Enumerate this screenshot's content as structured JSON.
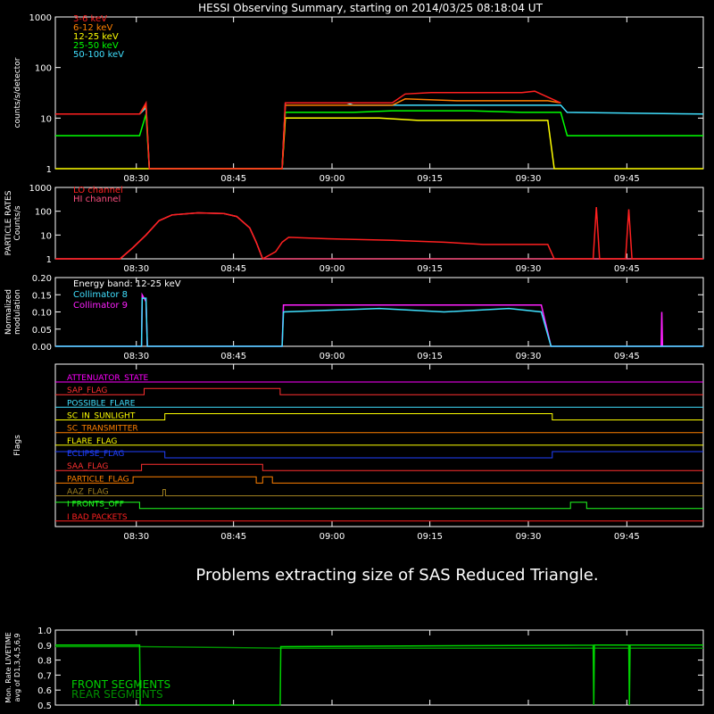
{
  "title": "HESSI Observing Summary, starting on 2014/03/25 08:18:04 UT",
  "message": "Problems extracting size of SAS Reduced Triangle.",
  "time_ticks": [
    "08:30",
    "08:45",
    "09:00",
    "09:15",
    "09:30",
    "09:45"
  ],
  "chart_data": [
    {
      "type": "line",
      "name": "count-rates",
      "ylabel": "counts/s/detector",
      "yscale": "log",
      "ylim": [
        1,
        1000
      ],
      "yticks": [
        "1",
        "10",
        "100",
        "1000"
      ],
      "series": [
        {
          "name": "3-6 keV",
          "color": "#ff2020",
          "points": [
            [
              0,
              12
            ],
            [
              13,
              12
            ],
            [
              14,
              20
            ],
            [
              14.5,
              1
            ],
            [
              35,
              1
            ],
            [
              35.5,
              20
            ],
            [
              52,
              20
            ],
            [
              54,
              30
            ],
            [
              58,
              32
            ],
            [
              72,
              32
            ],
            [
              74,
              34
            ],
            [
              76,
              26
            ],
            [
              78,
              20
            ]
          ]
        },
        {
          "name": "6-12 keV",
          "color": "#ff8000",
          "points": [
            [
              0,
              12
            ],
            [
              13,
              12
            ],
            [
              14,
              18
            ],
            [
              14.5,
              1
            ],
            [
              35,
              1
            ],
            [
              35.5,
              18
            ],
            [
              52,
              18
            ],
            [
              54,
              24
            ],
            [
              62,
              22
            ],
            [
              72,
              22
            ],
            [
              76,
              22
            ],
            [
              78,
              20
            ]
          ]
        },
        {
          "name": "12-25 keV",
          "color": "#ffff00",
          "points": [
            [
              0,
              1
            ],
            [
              35,
              1
            ],
            [
              35.5,
              10
            ],
            [
              50,
              10
            ],
            [
              56,
              9
            ],
            [
              64,
              9
            ],
            [
              72,
              9
            ],
            [
              76,
              9
            ],
            [
              77,
              1
            ],
            [
              100,
              1
            ]
          ]
        },
        {
          "name": "25-50 keV",
          "color": "#00ff00",
          "points": [
            [
              0,
              4.5
            ],
            [
              13,
              4.5
            ],
            [
              14,
              12
            ],
            [
              14.5,
              1
            ],
            [
              35,
              1
            ],
            [
              35.5,
              13
            ],
            [
              46,
              13
            ],
            [
              52,
              14
            ],
            [
              64,
              14
            ],
            [
              72,
              13
            ],
            [
              78,
              13
            ],
            [
              79,
              4.5
            ],
            [
              100,
              4.5
            ]
          ]
        },
        {
          "name": "50-100 keV",
          "color": "#40e0ff",
          "points": [
            [
              0,
              12
            ],
            [
              13,
              12
            ],
            [
              14,
              16
            ],
            [
              14.5,
              1
            ],
            [
              35,
              1
            ],
            [
              35.5,
              20
            ],
            [
              45,
              20
            ],
            [
              46,
              18
            ],
            [
              56,
              18
            ],
            [
              66,
              18
            ],
            [
              72,
              18
            ],
            [
              78,
              18
            ],
            [
              79,
              13
            ],
            [
              100,
              12
            ]
          ]
        }
      ]
    },
    {
      "type": "line",
      "name": "particle-rates",
      "ylabel": "PARTICLE RATES Counts/s",
      "yscale": "log",
      "ylim": [
        1,
        1000
      ],
      "yticks": [
        "1",
        "10",
        "100",
        "1000"
      ],
      "series": [
        {
          "name": "LO channel",
          "color": "#ff2020",
          "points": [
            [
              0,
              1
            ],
            [
              10,
              1
            ],
            [
              12,
              3
            ],
            [
              14,
              10
            ],
            [
              16,
              40
            ],
            [
              18,
              70
            ],
            [
              22,
              85
            ],
            [
              26,
              80
            ],
            [
              28,
              60
            ],
            [
              30,
              20
            ],
            [
              31,
              5
            ],
            [
              32,
              1
            ],
            [
              34,
              2
            ],
            [
              35,
              5
            ],
            [
              36,
              8
            ],
            [
              42,
              7
            ],
            [
              52,
              6
            ],
            [
              60,
              5
            ],
            [
              66,
              4
            ],
            [
              72,
              4
            ],
            [
              76,
              4
            ],
            [
              77,
              1
            ],
            [
              83,
              1
            ],
            [
              83.5,
              150
            ],
            [
              84,
              1
            ],
            [
              88,
              1
            ],
            [
              88.5,
              120
            ],
            [
              89,
              1
            ],
            [
              100,
              1
            ]
          ]
        },
        {
          "name": "HI channel",
          "color": "#ff5080",
          "points": [
            [
              0,
              1
            ],
            [
              10,
              1
            ],
            [
              12,
              3
            ],
            [
              14,
              10
            ],
            [
              16,
              40
            ],
            [
              18,
              70
            ],
            [
              22,
              85
            ],
            [
              26,
              80
            ],
            [
              28,
              60
            ],
            [
              30,
              20
            ],
            [
              31,
              5
            ],
            [
              32,
              1
            ],
            [
              100,
              1
            ]
          ]
        }
      ]
    },
    {
      "type": "line",
      "name": "modulation",
      "ylabel": "Normalized modulation",
      "annotation": "Energy band: 12-25 keV",
      "ylim": [
        0,
        0.2
      ],
      "yticks": [
        "0.00",
        "0.05",
        "0.10",
        "0.15",
        "0.20"
      ],
      "series": [
        {
          "name": "Collimator 8",
          "color": "#40e0ff",
          "points": [
            [
              0,
              0
            ],
            [
              13.3,
              0
            ],
            [
              13.4,
              0.14
            ],
            [
              14,
              0.14
            ],
            [
              14.2,
              0
            ],
            [
              35,
              0
            ],
            [
              35.2,
              0.1
            ],
            [
              50,
              0.11
            ],
            [
              60,
              0.1
            ],
            [
              70,
              0.11
            ],
            [
              75,
              0.1
            ],
            [
              76.5,
              0
            ],
            [
              100,
              0
            ]
          ]
        },
        {
          "name": "Collimator 9",
          "color": "#ff20ff",
          "points": [
            [
              0,
              0
            ],
            [
              13.3,
              0
            ],
            [
              13.4,
              0.15
            ],
            [
              14,
              0.13
            ],
            [
              14.2,
              0
            ],
            [
              35,
              0
            ],
            [
              35.2,
              0.12
            ],
            [
              50,
              0.12
            ],
            [
              60,
              0.12
            ],
            [
              70,
              0.12
            ],
            [
              75,
              0.12
            ],
            [
              76.5,
              0
            ],
            [
              93.5,
              0
            ],
            [
              93.6,
              0.1
            ],
            [
              93.7,
              0
            ],
            [
              100,
              0
            ]
          ]
        }
      ]
    },
    {
      "type": "line",
      "name": "flags",
      "ylabel": "Flags",
      "series": [
        {
          "name": "ATTENUATOR_STATE",
          "color": "#ff00ff",
          "points": [
            [
              0,
              0
            ],
            [
              100,
              0
            ]
          ]
        },
        {
          "name": "SAP_FLAG",
          "color": "#ff3030",
          "points": [
            [
              0,
              0
            ],
            [
              13.7,
              0
            ],
            [
              13.7,
              1
            ],
            [
              34.7,
              1
            ],
            [
              34.7,
              0
            ],
            [
              100,
              0
            ]
          ]
        },
        {
          "name": "POSSIBLE_FLARE",
          "color": "#40e0ff",
          "points": [
            [
              0,
              0
            ],
            [
              100,
              0
            ]
          ]
        },
        {
          "name": "SC_IN_SUNLIGHT",
          "color": "#ffff00",
          "points": [
            [
              0,
              0
            ],
            [
              16.9,
              0
            ],
            [
              16.9,
              1
            ],
            [
              76.7,
              1
            ],
            [
              76.7,
              0
            ],
            [
              100,
              0
            ]
          ]
        },
        {
          "name": "SC_TRANSMITTER",
          "color": "#ff8000",
          "points": [
            [
              0,
              0
            ],
            [
              100,
              0
            ]
          ]
        },
        {
          "name": "FLARE_FLAG",
          "color": "#ffff00",
          "points": [
            [
              0,
              0
            ],
            [
              100,
              0
            ]
          ]
        },
        {
          "name": "ECLIPSE_FLAG",
          "color": "#2040ff",
          "points": [
            [
              0,
              1
            ],
            [
              16.9,
              1
            ],
            [
              16.9,
              0
            ],
            [
              76.7,
              0
            ],
            [
              76.7,
              1
            ],
            [
              100,
              1
            ]
          ]
        },
        {
          "name": "SAA_FLAG",
          "color": "#ff3030",
          "points": [
            [
              0,
              0
            ],
            [
              13.3,
              0
            ],
            [
              13.3,
              1
            ],
            [
              32,
              1
            ],
            [
              32,
              0
            ],
            [
              100,
              0
            ]
          ]
        },
        {
          "name": "PARTICLE_FLAG",
          "color": "#ff8000",
          "points": [
            [
              0,
              0
            ],
            [
              12,
              0
            ],
            [
              12,
              1
            ],
            [
              31,
              1
            ],
            [
              31,
              0
            ],
            [
              32,
              0
            ],
            [
              32,
              1
            ],
            [
              33.5,
              1
            ],
            [
              33.5,
              0
            ],
            [
              100,
              0
            ]
          ]
        },
        {
          "name": "AAZ_FLAG",
          "color": "#a08020",
          "points": [
            [
              0,
              0
            ],
            [
              16.6,
              0
            ],
            [
              16.6,
              1
            ],
            [
              17,
              1
            ],
            [
              17,
              0
            ],
            [
              100,
              0
            ]
          ]
        },
        {
          "name": "I FRONTS_OFF",
          "color": "#20ff20",
          "points": [
            [
              0,
              1
            ],
            [
              13,
              1
            ],
            [
              13,
              0
            ],
            [
              79.5,
              0
            ],
            [
              79.5,
              1
            ],
            [
              82,
              1
            ],
            [
              82,
              0
            ],
            [
              100,
              0
            ]
          ]
        },
        {
          "name": "I BAD PACKETS",
          "color": "#ff2020",
          "points": [
            [
              0,
              0
            ],
            [
              100,
              0
            ]
          ]
        }
      ]
    },
    {
      "type": "line",
      "name": "livetime",
      "ylabel": "Mon. Rate LIVETIME avg of D1,3,4,5,6,9",
      "ylim": [
        0.5,
        1.0
      ],
      "yticks": [
        "0.5",
        "0.6",
        "0.7",
        "0.8",
        "0.9",
        "1.0"
      ],
      "series": [
        {
          "name": "FRONT SEGMENTS",
          "color": "#00d000",
          "points": [
            [
              0,
              0.9
            ],
            [
              13,
              0.9
            ],
            [
              13.1,
              0.5
            ],
            [
              34.7,
              0.5
            ],
            [
              34.8,
              0.89
            ],
            [
              83,
              0.9
            ],
            [
              83.1,
              0.5
            ],
            [
              83.2,
              0.9
            ],
            [
              88.5,
              0.9
            ],
            [
              88.6,
              0.5
            ],
            [
              88.7,
              0.9
            ],
            [
              100,
              0.9
            ]
          ]
        },
        {
          "name": "REAR SEGMENTS",
          "color": "#009000",
          "points": [
            [
              0,
              0.89
            ],
            [
              13,
              0.89
            ],
            [
              34.8,
              0.88
            ],
            [
              100,
              0.88
            ]
          ]
        }
      ]
    }
  ]
}
